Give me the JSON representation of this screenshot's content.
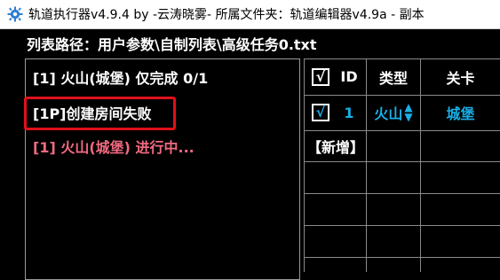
{
  "window": {
    "title": "轨道执行器v4.9.4 by -云涛晓雾- 所属文件夹：轨道编辑器v4.9a - 副本"
  },
  "path": {
    "label": "列表路径：用户参数\\自制列表\\高级任务0.txt"
  },
  "tasks": [
    {
      "text": "[1] 火山(城堡) 仅完成 0/1"
    },
    {
      "text": "[1P]创建房间失败"
    },
    {
      "text": "[1] 火山(城堡) 进行中..."
    }
  ],
  "table": {
    "headers": {
      "check": "√",
      "id": "ID",
      "type": "类型",
      "level": "关卡"
    },
    "rows": [
      {
        "check": "√",
        "id": "1",
        "type": "火山",
        "level": "城堡"
      }
    ],
    "add_label": "【新增】"
  },
  "colors": {
    "status_done": "#ffffff",
    "status_error": "#ffffff",
    "status_running": "#f06a80",
    "highlight": "#e0101a",
    "accent": "#19b0e8"
  },
  "icons": {
    "app": "gear-icon",
    "spinner_up": "triangle-up-icon",
    "spinner_down": "triangle-down-icon"
  }
}
